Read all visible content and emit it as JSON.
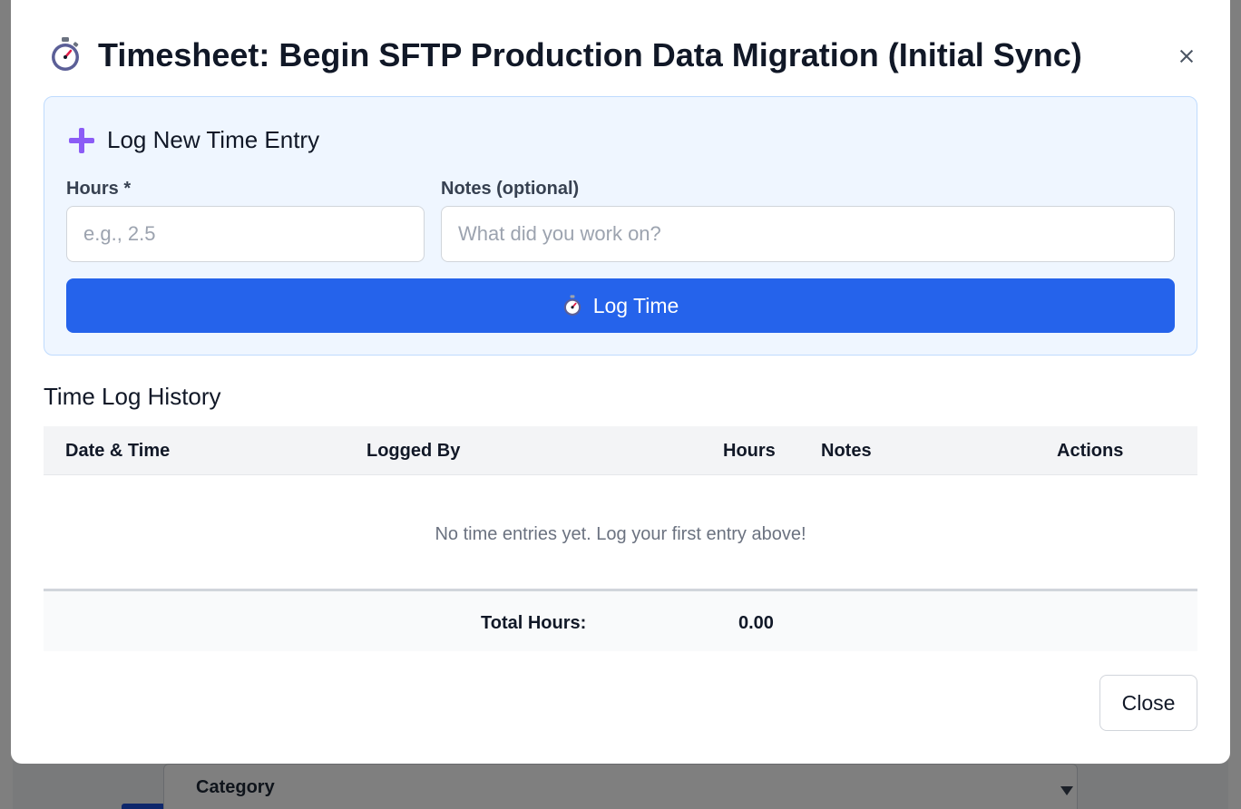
{
  "modal": {
    "title": "Timesheet: Begin SFTP Production Data Migration (Initial Sync)",
    "title_icon": "stopwatch-icon",
    "close_icon": "close-icon"
  },
  "entry_form": {
    "heading": "Log New Time Entry",
    "heading_icon": "plus-icon",
    "hours_label": "Hours *",
    "hours_placeholder": "e.g., 2.5",
    "hours_value": "",
    "notes_label": "Notes (optional)",
    "notes_placeholder": "What did you work on?",
    "notes_value": "",
    "submit_label": "Log Time",
    "submit_icon": "stopwatch-icon"
  },
  "history": {
    "heading": "Time Log History",
    "columns": [
      "Date & Time",
      "Logged By",
      "Hours",
      "Notes",
      "Actions"
    ],
    "rows": [],
    "empty_message": "No time entries yet. Log your first entry above!",
    "total_label": "Total Hours:",
    "total_value": "0.00"
  },
  "footer": {
    "close_label": "Close"
  },
  "background": {
    "category_label": "Category"
  },
  "colors": {
    "primary": "#2563eb",
    "panel_bg": "#eff6ff",
    "panel_border": "#bfdbfe",
    "plus_icon": "#8b5cf6"
  }
}
